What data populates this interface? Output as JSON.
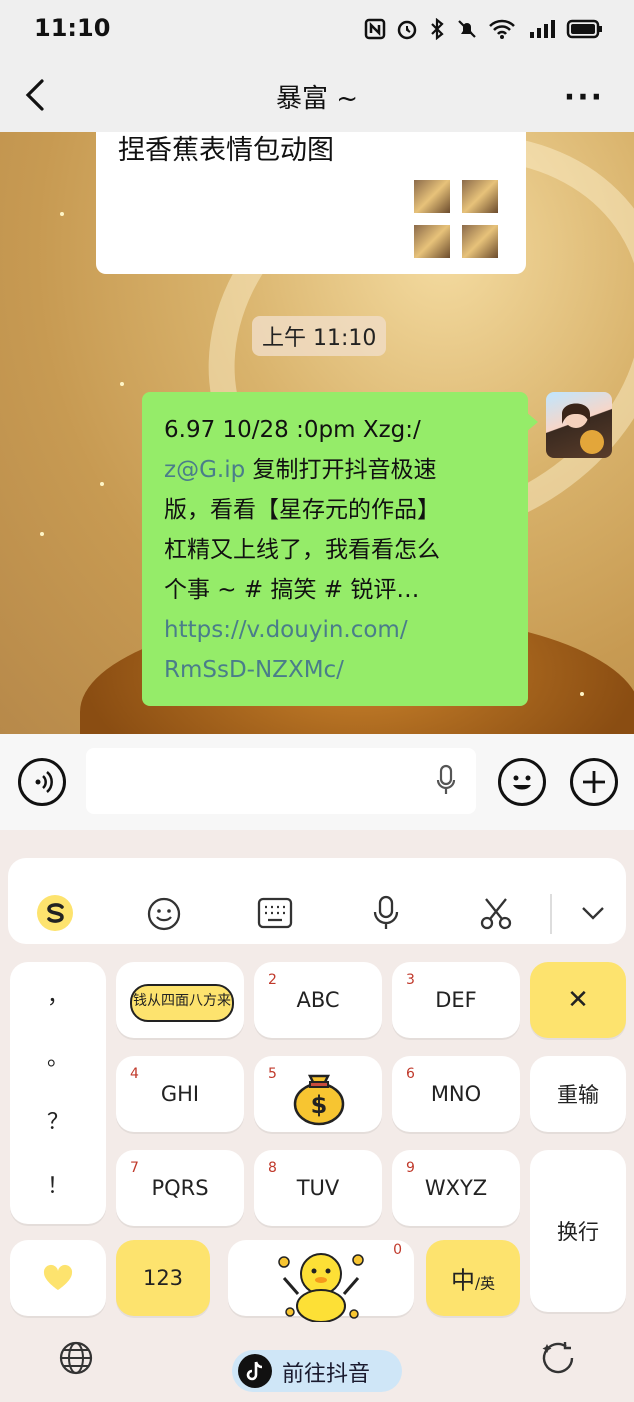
{
  "status": {
    "time": "11:10"
  },
  "header": {
    "title": "暴富 ~"
  },
  "chat": {
    "card_text": "捏香蕉表情包动图",
    "time_label": "上午 11:10",
    "message": {
      "line1": "6.97 10/28 :0pm Xzg:/",
      "line2_link": "z@G.ip",
      "line2_text": " 复制打开抖音极速",
      "line3": "版，看看【星存元的作品】",
      "line4": "杠精又上线了，我看看怎么",
      "line5": "个事 ~ # 搞笑 # 锐评…",
      "url1": "https://v.douyin.com/",
      "url2": "RmSsD-NZXMc/"
    }
  },
  "keyboard": {
    "punct": [
      "，",
      "。",
      "？",
      "！"
    ],
    "sticker_text": "钱从四面八方来",
    "keys": {
      "k2_num": "2",
      "k2": "ABC",
      "k3_num": "3",
      "k3": "DEF",
      "k4_num": "4",
      "k4": "GHI",
      "k5_num": "5",
      "k6_num": "6",
      "k6": "MNO",
      "k7_num": "7",
      "k7": "PQRS",
      "k8_num": "8",
      "k8": "TUV",
      "k9_num": "9",
      "k9": "WXYZ",
      "k0_num": "0",
      "delete": "✕",
      "reinput": "重输",
      "newline": "换行",
      "num": "123",
      "lang_main": "中",
      "lang_sub": "/英"
    },
    "douyin_label": "前往抖音"
  },
  "colors": {
    "bubble": "#95ec69",
    "accent_yellow": "#fde36e",
    "link": "#4a7d8a"
  }
}
